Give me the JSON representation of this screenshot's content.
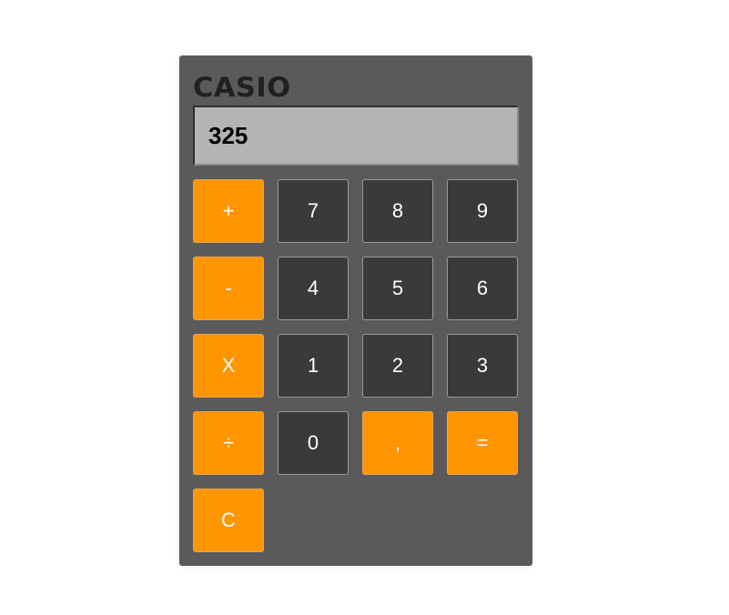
{
  "calculator": {
    "brand": "CASIO",
    "display": "325",
    "keys": {
      "plus": "+",
      "seven": "7",
      "eight": "8",
      "nine": "9",
      "minus": "-",
      "four": "4",
      "five": "5",
      "six": "6",
      "multiply": "X",
      "one": "1",
      "two": "2",
      "three": "3",
      "divide": "÷",
      "zero": "0",
      "comma": ",",
      "equals": "=",
      "clear": "C"
    }
  },
  "colors": {
    "body": "#5a5a5a",
    "display": "#b4b4b4",
    "operator_key": "#ff9500",
    "digit_key": "#3a3a3a"
  }
}
